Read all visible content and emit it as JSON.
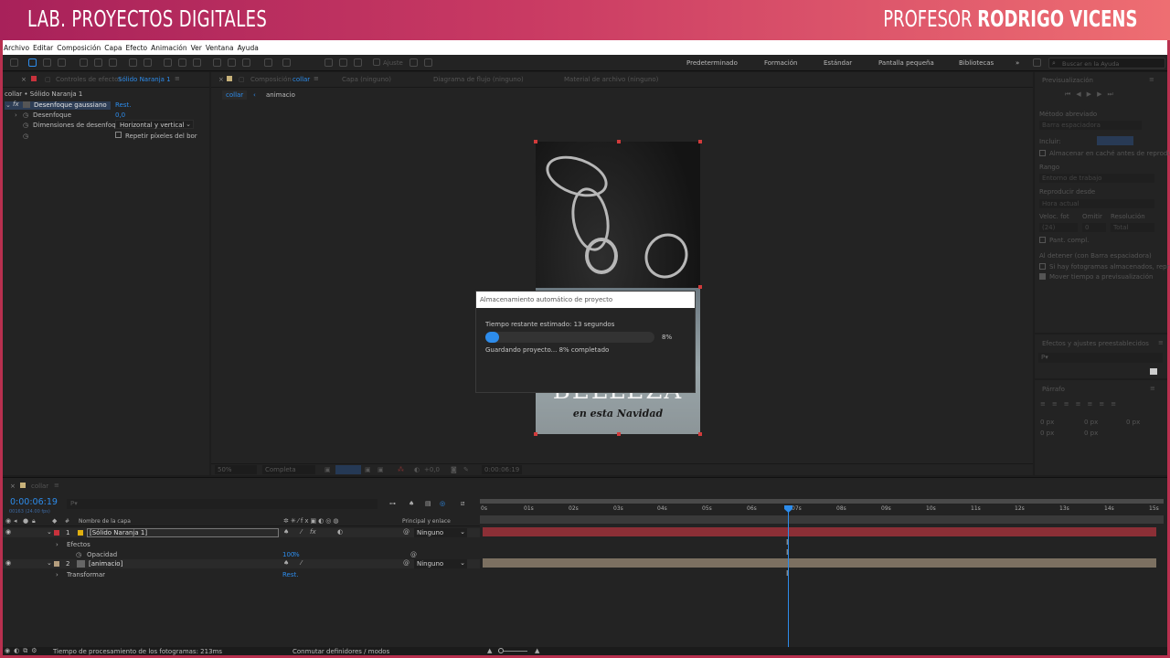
{
  "banner": {
    "left": "LAB. PROYECTOS DIGITALES",
    "right_prefix": "PROFESOR ",
    "right_name": "RODRIGO VICENS"
  },
  "menu": [
    "Archivo",
    "Editar",
    "Composición",
    "Capa",
    "Efecto",
    "Animación",
    "Ver",
    "Ventana",
    "Ayuda"
  ],
  "toolbar": {
    "ajuste": "Ajuste",
    "workspaces": [
      "Predeterminado",
      "Formación",
      "Estándar",
      "Pantalla pequeña",
      "Bibliotecas"
    ],
    "search_placeholder": "Buscar en la Ayuda"
  },
  "effects_panel": {
    "tab_label": "Controles de efectos",
    "tab_target": "Sólido Naranja 1",
    "breadcrumb": "collar • Sólido Naranja 1",
    "effect_name": "Desenfoque gaussiano",
    "reset": "Rest.",
    "props": [
      {
        "label": "Desenfoque",
        "value": "0,0"
      },
      {
        "label": "Dimensiones de desenfoq",
        "value": "Horizontal y vertical"
      },
      {
        "label": "Repetir píxeles del bor",
        "value": ""
      }
    ]
  },
  "comp_panel": {
    "tab_comp": "Composición",
    "tab_comp_name": "collar",
    "tab_capa": "Capa  (ninguno)",
    "tab_flujo": "Diagrama de flujo  (ninguno)",
    "tab_material": "Material de archivo  (ninguno)",
    "crumb_active": "collar",
    "crumb_next": "animacio",
    "image_text_big": "BELLEZA",
    "image_text_script": "en esta Navidad",
    "footer_zoom": "50%",
    "footer_res": "Completa",
    "footer_offset": "+0,0",
    "footer_time": "0:00:06:19"
  },
  "dialog": {
    "title": "Almacenamiento automático de proyecto",
    "time_remaining": "Tiempo restante estimado: 13 segundos",
    "percent_label": "8%",
    "progress": 0.08,
    "status": "Guardando proyecto... 8% completado"
  },
  "preview_panel": {
    "title": "Previsualización",
    "shortcut_label": "Método abreviado",
    "shortcut_value": "Barra espaciadora",
    "include": "Incluir:",
    "cache": "Almacenar en caché antes de reproducir",
    "range": "Rango",
    "range_value": "Entorno de trabajo",
    "play_from": "Reproducir desde",
    "play_from_value": "Hora actual",
    "fps_label": "Veloc. fot",
    "skip_label": "Omitir",
    "res_label": "Resolución",
    "fps_value": "(24)",
    "skip_value": "0",
    "res_value": "Total",
    "fullscreen": "Pant. compl.",
    "on_stop": "Al detener (con Barra espaciadora)",
    "cached": "Si hay fotogramas almacenados, repr",
    "move_time": "Mover tiempo a previsualización"
  },
  "effects_presets": {
    "title": "Efectos y ajustes preestablecidos",
    "search_placeholder": "P▾"
  },
  "paragraph_panel": {
    "title": "Párrafo",
    "vals": [
      "0 px",
      "0 px",
      "0 px",
      "0 px",
      "0 px"
    ]
  },
  "timeline": {
    "tab": "collar",
    "timecode": "0:00:06:19",
    "fps_note": "00163 (24.00 fps)",
    "search_placeholder": "P▾",
    "col_num": "#",
    "col_name": "Nombre de la capa",
    "col_parent": "Principal y enlace",
    "ruler": [
      "0s",
      "01s",
      "02s",
      "03s",
      "04s",
      "05s",
      "06s",
      "07s",
      "08s",
      "09s",
      "10s",
      "11s",
      "12s",
      "13s",
      "14s",
      "15s"
    ],
    "layers": [
      {
        "num": "1",
        "name": "[Sólido Naranja 1]",
        "parent": "Ninguno",
        "color": "#e0b010",
        "bar": "#8c2f36"
      },
      {
        "num": "2",
        "name": "[animacio]",
        "parent": "Ninguno",
        "color": "#b59e7e",
        "bar": "#7c7061"
      }
    ],
    "effects_group": "Efectos",
    "opacity_label": "Opacidad",
    "opacity_value": "100",
    "opacity_unit": "%",
    "transform_label": "Transformar",
    "transform_value": "Rest."
  },
  "statusbar": {
    "render_time": "Tiempo de procesamiento de los fotogramas: 213ms",
    "toggle": "Conmutar definidores / modos"
  }
}
